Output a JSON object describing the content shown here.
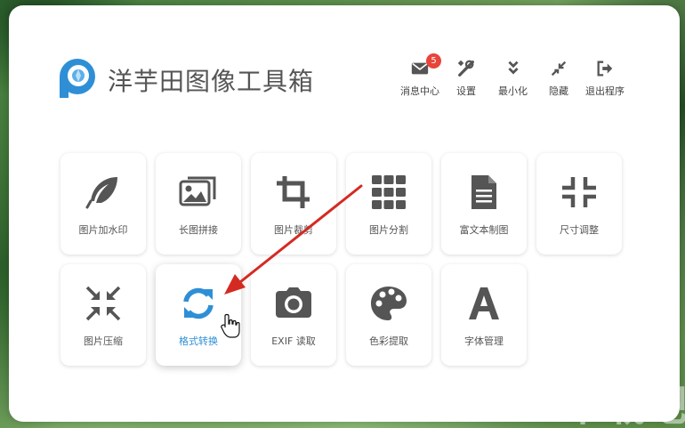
{
  "app": {
    "title": "洋芋田图像工具箱"
  },
  "toolbar": {
    "messages": {
      "label": "消息中心",
      "badge": "5"
    },
    "settings": {
      "label": "设置"
    },
    "minimize": {
      "label": "最小化"
    },
    "hide": {
      "label": "隐藏"
    },
    "exit": {
      "label": "退出程序"
    }
  },
  "tools": [
    {
      "label": "图片加水印",
      "icon": "feather-icon"
    },
    {
      "label": "长图拼接",
      "icon": "images-icon"
    },
    {
      "label": "图片裁剪",
      "icon": "crop-icon"
    },
    {
      "label": "图片分割",
      "icon": "grid-icon"
    },
    {
      "label": "富文本制图",
      "icon": "document-icon"
    },
    {
      "label": "尺寸调整",
      "icon": "compress-icon"
    },
    {
      "label": "图片压缩",
      "icon": "shrink-icon"
    },
    {
      "label": "格式转换",
      "icon": "refresh-icon"
    },
    {
      "label": "EXIF 读取",
      "icon": "camera-icon"
    },
    {
      "label": "色彩提取",
      "icon": "palette-icon"
    },
    {
      "label": "字体管理",
      "icon": "font-icon"
    }
  ],
  "watermark": "下载吧",
  "colors": {
    "accent": "#2e8fd6",
    "icon": "#555555",
    "badge": "#e8443a",
    "arrow": "#d42a22"
  }
}
